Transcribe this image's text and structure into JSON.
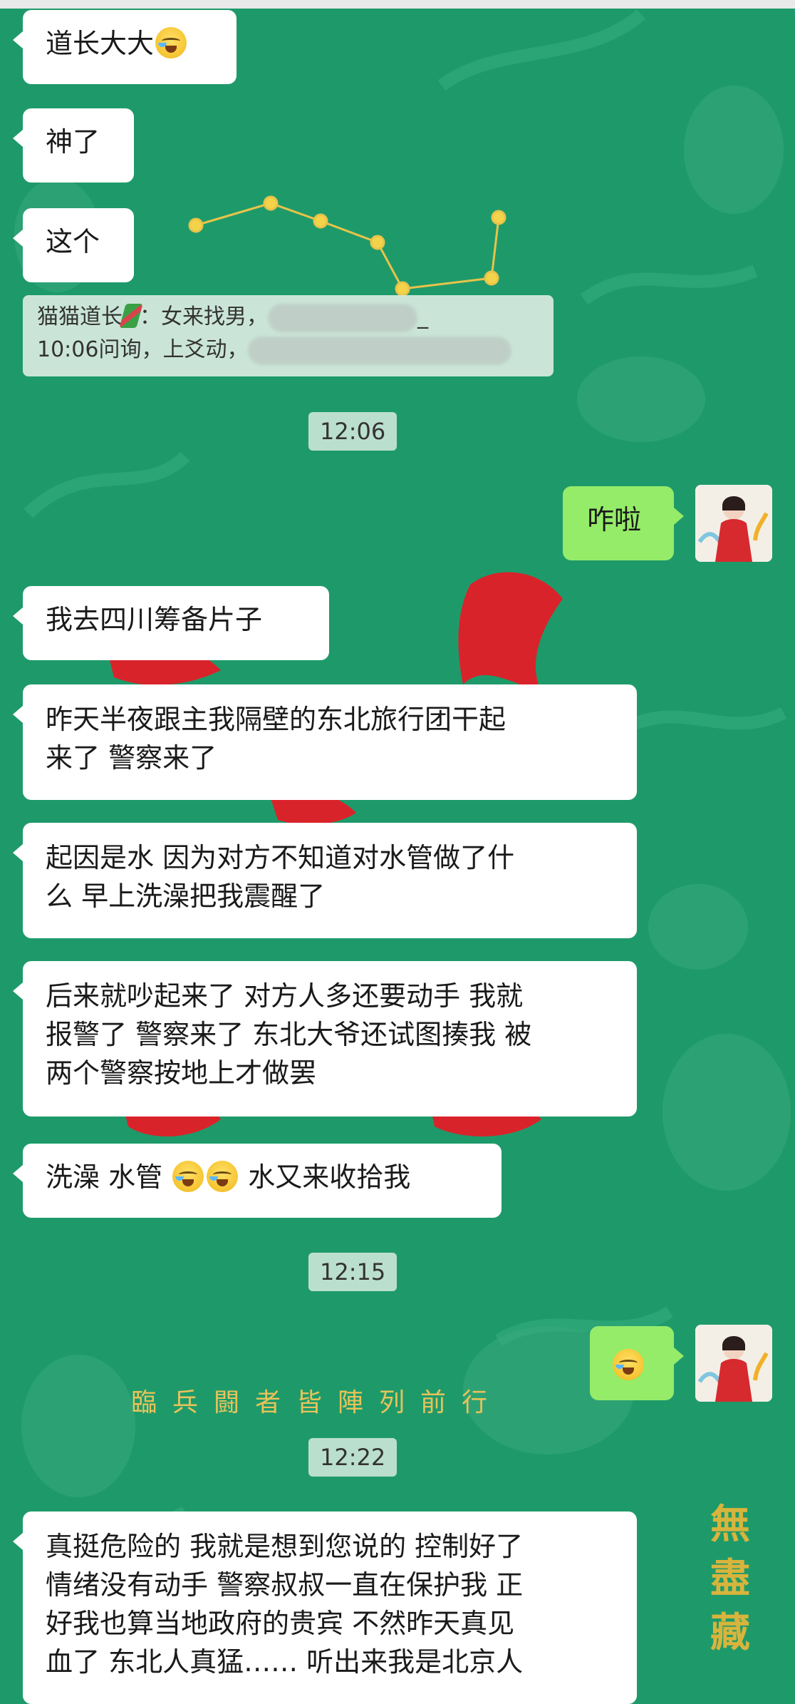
{
  "messages": {
    "m1": "道长大大",
    "m2": "神了",
    "m3": "这个",
    "quote": {
      "prefix": "猫猫道长",
      "line1": "：女来找男，",
      "line1_end": "_",
      "line2": "10:06问询，上爻动，"
    },
    "t1": "12:06",
    "out1": "咋啦",
    "m4": "我去四川筹备片子",
    "m5_l1": "昨天半夜跟主我隔壁的东北旅行团干起",
    "m5_l2": "来了 警察来了",
    "m6_l1": "起因是水 因为对方不知道对水管做了什",
    "m6_l2": "么 早上洗澡把我震醒了",
    "m7_l1": "后来就吵起来了 对方人多还要动手 我就",
    "m7_l2": "报警了 警察来了 东北大爷还试图揍我 被",
    "m7_l3": "两个警察按地上才做罢",
    "m8_a": "洗澡 水管",
    "m8_b": "水又来收拾我",
    "t2": "12:15",
    "t3": "12:22",
    "m9_l1": "真挺危险的 我就是想到您说的 控制好了",
    "m9_l2": "情绪没有动手 警察叔叔一直在保护我 正",
    "m9_l3": "好我也算当地政府的贵宾 不然昨天真见",
    "m9_l4": "血了 东北人真猛…… 听出来我是北京人"
  },
  "background": {
    "banner": "臨兵闘者皆陣列前行",
    "seal": "無盡藏"
  },
  "icons": {
    "emoji": "loudly-crying-face-emoji",
    "quote_icon": "sugarcane-emoji",
    "avatar": "user-avatar"
  },
  "colors": {
    "background": "#1e9a6a",
    "incoming_bubble": "#ffffff",
    "outgoing_bubble": "#95ec69",
    "accent_red": "#d9232a",
    "accent_gold": "#e7c35a"
  }
}
